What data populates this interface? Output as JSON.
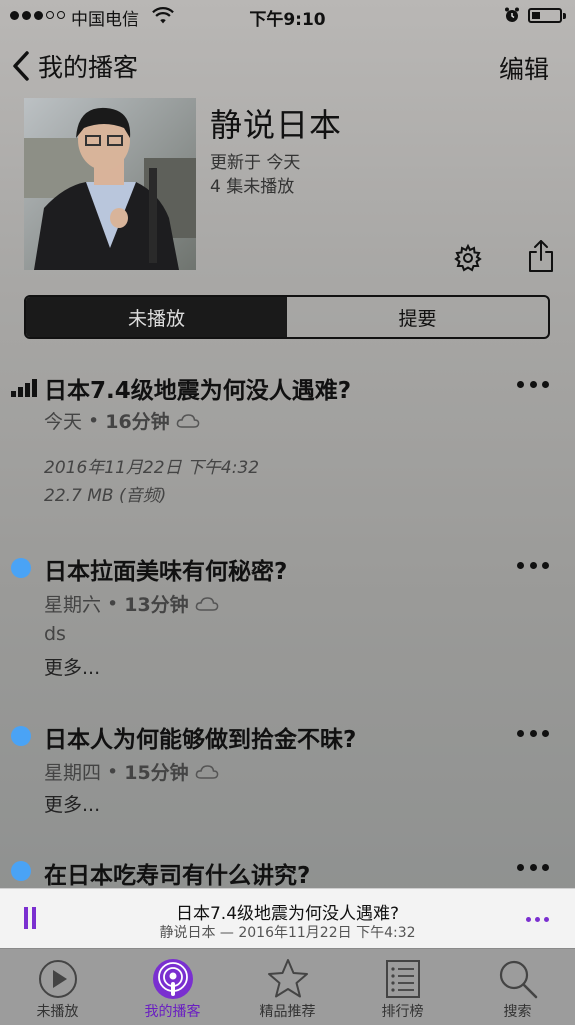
{
  "status_bar": {
    "carrier": "中国电信",
    "time": "下午9:10"
  },
  "nav": {
    "back_label": "我的播客",
    "edit_label": "编辑"
  },
  "podcast": {
    "title": "静说日本",
    "updated": "更新于 今天",
    "unplayed_count": "4 集未播放"
  },
  "segments": [
    {
      "label": "未播放",
      "active": true
    },
    {
      "label": "提要",
      "active": false
    }
  ],
  "episodes": [
    {
      "title": "日本7.4级地震为何没人遇难?",
      "day": "今天",
      "duration": "16分钟",
      "date": "2016年11月22日 下午4:32",
      "size": "22.7 MB (音频)",
      "playing": true
    },
    {
      "title": "日本拉面美味有何秘密?",
      "day": "星期六",
      "duration": "13分钟",
      "desc": "ds",
      "more": "更多..."
    },
    {
      "title": "日本人为何能够做到拾金不昧?",
      "day": "星期四",
      "duration": "15分钟",
      "more": "更多..."
    },
    {
      "title": "在日本吃寿司有什么讲究?"
    }
  ],
  "mini_player": {
    "title": "日本7.4级地震为何没人遇难?",
    "subtitle": "静说日本 — 2016年11月22日 下午4:32"
  },
  "tabs": [
    {
      "label": "未播放",
      "icon": "play-circle-icon"
    },
    {
      "label": "我的播客",
      "icon": "podcast-icon",
      "active": true
    },
    {
      "label": "精品推荐",
      "icon": "star-icon"
    },
    {
      "label": "排行榜",
      "icon": "list-icon"
    },
    {
      "label": "搜索",
      "icon": "search-icon"
    }
  ],
  "colors": {
    "accent": "#7a2fd0",
    "unplayed_dot": "#4aa3f5"
  }
}
